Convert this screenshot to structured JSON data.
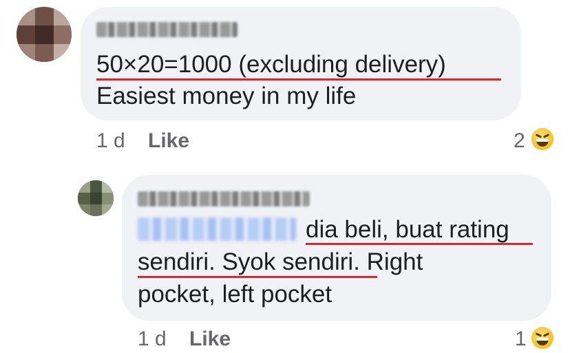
{
  "comment1": {
    "text_line1": "50×20=1000  (excluding delivery)",
    "text_line2": "Easiest money in my life",
    "time": "1 d",
    "like_label": "Like",
    "reaction_count": "2",
    "reaction_icon": "haha-emoji-icon"
  },
  "reply1": {
    "text_line1_rest": "dia beli, buat rating",
    "text_line2": "sendiri. Syok sendiri. Right",
    "text_line3": "pocket, left pocket",
    "time": "1 d",
    "like_label": "Like",
    "reaction_count": "1",
    "reaction_icon": "haha-emoji-icon"
  },
  "colors": {
    "bubble": "#f0f2f5",
    "meta_text": "#65676b",
    "underline": "#e0262b"
  }
}
